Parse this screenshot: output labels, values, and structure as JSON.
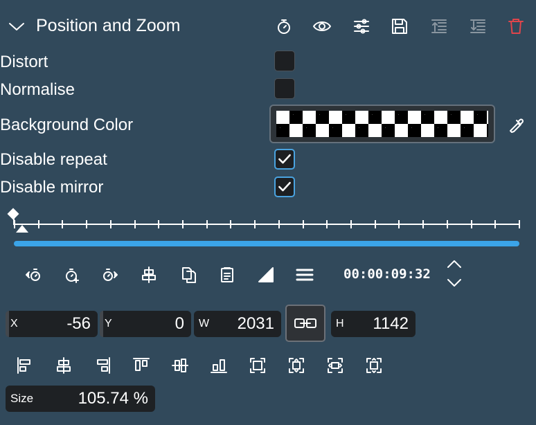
{
  "header": {
    "title": "Position and Zoom",
    "icons": [
      "chevron-down-icon",
      "stopwatch-icon",
      "eye-icon",
      "sliders-icon",
      "save-icon",
      "move-up-icon",
      "move-down-icon",
      "delete-icon"
    ]
  },
  "params": {
    "distort": {
      "label": "Distort",
      "checked": false
    },
    "normalise": {
      "label": "Normalise",
      "checked": false
    },
    "background_color": {
      "label": "Background Color"
    },
    "disable_repeat": {
      "label": "Disable repeat",
      "checked": true
    },
    "disable_mirror": {
      "label": "Disable mirror",
      "checked": true
    }
  },
  "keyframes": {
    "timecode": "00:00:09:32",
    "progress": 1.0,
    "toolbar_icons": [
      "previous-keyframe-icon",
      "add-keyframe-icon",
      "next-keyframe-icon",
      "center-icon",
      "copy-icon",
      "paste-icon",
      "interpolation-icon",
      "menu-icon"
    ]
  },
  "geometry": {
    "x": {
      "key": "X",
      "value": "-56"
    },
    "y": {
      "key": "Y",
      "value": "0"
    },
    "w": {
      "key": "W",
      "value": "2031"
    },
    "h": {
      "key": "H",
      "value": "1142"
    },
    "size": {
      "key": "Size",
      "value": "105.74 %"
    }
  },
  "align_icons": [
    "align-left-icon",
    "align-hcenter-icon",
    "align-right-icon",
    "align-top-icon",
    "align-vcenter-icon",
    "align-bottom-icon",
    "fit-icon",
    "fit-height-icon",
    "fit-width-icon",
    "fit-all-icon"
  ],
  "colors": {
    "background": "#31495b",
    "accent": "#3ba4e8",
    "delete": "#e0454b",
    "field": "#1e2124"
  }
}
